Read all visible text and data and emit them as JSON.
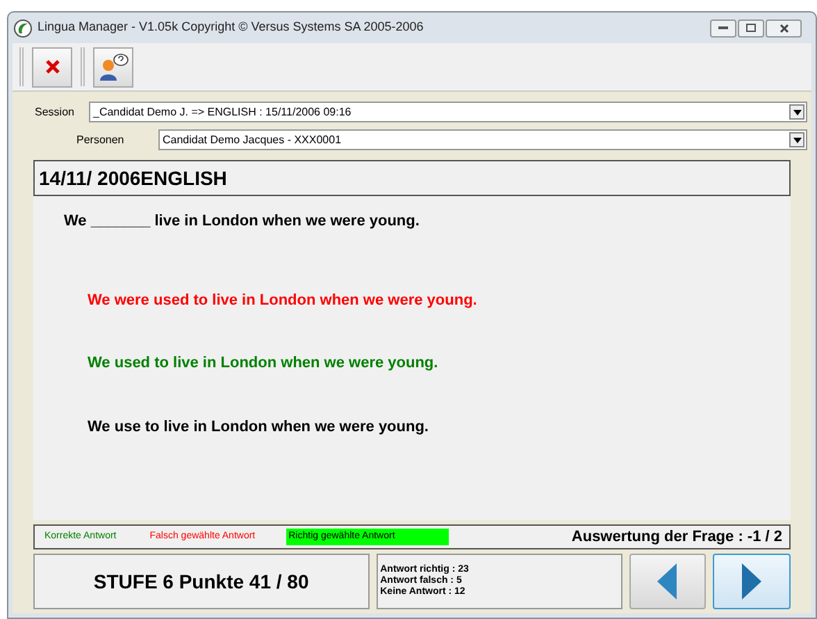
{
  "window": {
    "title": "Lingua Manager - V1.05k Copyright © Versus Systems SA 2005-2006"
  },
  "session": {
    "label": "Session",
    "value": "_Candidat Demo J. => ENGLISH : 15/11/2006 09:16"
  },
  "personen": {
    "label": "Personen",
    "value": "Candidat Demo Jacques - XXX0001"
  },
  "header": "14/11/ 2006ENGLISH",
  "question": "We _______ live in London when we were young.",
  "answers": [
    {
      "text": "We were used to live in London when we were young.",
      "kind": "wrong"
    },
    {
      "text": "We used to live in London when we were young.",
      "kind": "correct"
    },
    {
      "text": "We use to live in London when we were young.",
      "kind": "neutral"
    }
  ],
  "legend": [
    {
      "text": "Korrekte Antwort",
      "kind": "correct",
      "highlighted": false
    },
    {
      "text": "Falsch gewählte Antwort",
      "kind": "wrong",
      "highlighted": false
    },
    {
      "text": "Richtig gewählte Antwort",
      "kind": "neutral",
      "highlighted": true
    }
  ],
  "evaluation": "Auswertung der Frage : -1 / 2",
  "score": "STUFE 6 Punkte 41 / 80",
  "stats": [
    "Antwort richtig : 23",
    "Antwort falsch : 5",
    "Keine Antwort : 12"
  ]
}
